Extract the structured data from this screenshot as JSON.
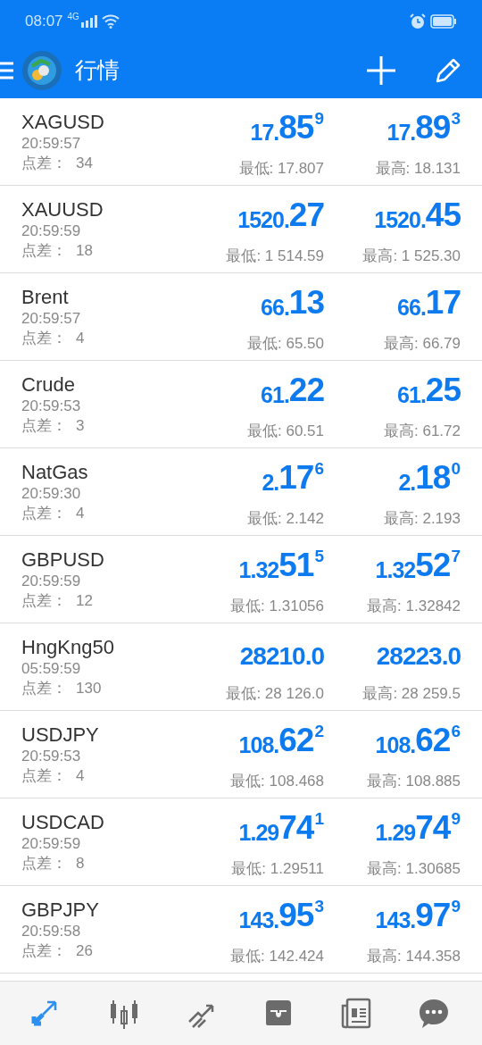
{
  "status_bar": {
    "time": "08:07",
    "network": "4G"
  },
  "header": {
    "title": "行情"
  },
  "quotes": [
    {
      "symbol": "XAGUSD",
      "time": "20:59:57",
      "spread_label": "点差：",
      "spread": "34",
      "bid": {
        "prefix": "17.",
        "big": "85",
        "sup": "9"
      },
      "ask": {
        "prefix": "17.",
        "big": "89",
        "sup": "3"
      },
      "low": "最低: 17.807",
      "high": "最高: 18.131"
    },
    {
      "symbol": "XAUUSD",
      "time": "20:59:59",
      "spread_label": "点差：",
      "spread": "18",
      "bid": {
        "prefix": "1520.",
        "big": "27"
      },
      "ask": {
        "prefix": "1520.",
        "big": "45"
      },
      "low": "最低: 1 514.59",
      "high": "最高: 1 525.30"
    },
    {
      "symbol": "Brent",
      "time": "20:59:57",
      "spread_label": "点差：",
      "spread": "4",
      "bid": {
        "prefix": "66.",
        "big": "13"
      },
      "ask": {
        "prefix": "66.",
        "big": "17"
      },
      "low": "最低: 65.50",
      "high": "最高: 66.79"
    },
    {
      "symbol": "Crude",
      "time": "20:59:53",
      "spread_label": "点差：",
      "spread": "3",
      "bid": {
        "prefix": "61.",
        "big": "22"
      },
      "ask": {
        "prefix": "61.",
        "big": "25"
      },
      "low": "最低: 60.51",
      "high": "最高: 61.72"
    },
    {
      "symbol": "NatGas",
      "time": "20:59:30",
      "spread_label": "点差：",
      "spread": "4",
      "bid": {
        "prefix": "2.",
        "big": "17",
        "sup": "6"
      },
      "ask": {
        "prefix": "2.",
        "big": "18",
        "sup": "0"
      },
      "low": "最低: 2.142",
      "high": "最高: 2.193"
    },
    {
      "symbol": "GBPUSD",
      "time": "20:59:59",
      "spread_label": "点差：",
      "spread": "12",
      "bid": {
        "prefix": "1.32",
        "big": "51",
        "sup": "5"
      },
      "ask": {
        "prefix": "1.32",
        "big": "52",
        "sup": "7"
      },
      "low": "最低: 1.31056",
      "high": "最高: 1.32842"
    },
    {
      "symbol": "HngKng50",
      "time": "05:59:59",
      "spread_label": "点差：",
      "spread": "130",
      "bid": {
        "prefix": "28210.0"
      },
      "ask": {
        "prefix": "28223.0"
      },
      "low": "最低: 28 126.0",
      "high": "最高: 28 259.5"
    },
    {
      "symbol": "USDJPY",
      "time": "20:59:53",
      "spread_label": "点差：",
      "spread": "4",
      "bid": {
        "prefix": "108.",
        "big": "62",
        "sup": "2"
      },
      "ask": {
        "prefix": "108.",
        "big": "62",
        "sup": "6"
      },
      "low": "最低: 108.468",
      "high": "最高: 108.885"
    },
    {
      "symbol": "USDCAD",
      "time": "20:59:59",
      "spread_label": "点差：",
      "spread": "8",
      "bid": {
        "prefix": "1.29",
        "big": "74",
        "sup": "1"
      },
      "ask": {
        "prefix": "1.29",
        "big": "74",
        "sup": "9"
      },
      "low": "最低: 1.29511",
      "high": "最高: 1.30685"
    },
    {
      "symbol": "GBPJPY",
      "time": "20:59:58",
      "spread_label": "点差：",
      "spread": "26",
      "bid": {
        "prefix": "143.",
        "big": "95",
        "sup": "3"
      },
      "ask": {
        "prefix": "143.",
        "big": "97",
        "sup": "9"
      },
      "low": "最低: 142.424",
      "high": "最高: 144.358"
    }
  ],
  "bottom_nav": [
    {
      "kind": "quotes",
      "selected": true
    },
    {
      "kind": "chart",
      "selected": false
    },
    {
      "kind": "trade",
      "selected": false
    },
    {
      "kind": "inbox",
      "selected": false
    },
    {
      "kind": "news",
      "selected": false
    },
    {
      "kind": "chat",
      "selected": false
    }
  ]
}
